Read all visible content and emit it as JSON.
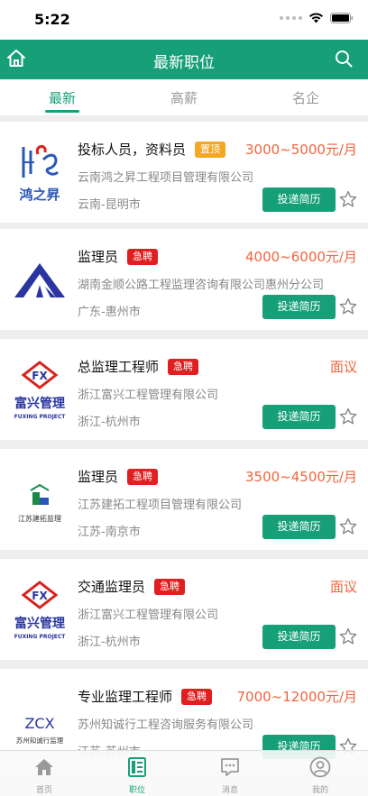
{
  "status": {
    "time": "5:22"
  },
  "header": {
    "title": "最新职位"
  },
  "tabs": [
    {
      "label": "最新"
    },
    {
      "label": "高薪"
    },
    {
      "label": "名企"
    }
  ],
  "colors": {
    "primary": "#17a078",
    "salary": "#f0643c",
    "urgent": "#e02020",
    "top": "#f5a623"
  },
  "jobs": [
    {
      "title": "投标人员，资料员",
      "badge": "置顶",
      "badge_type": "top",
      "salary": "3000~5000元/月",
      "company": "云南鸿之昇工程项目管理有限公司",
      "location": "云南-昆明市",
      "apply": "投递简历",
      "logo": "hong-zhi-sheng-logo",
      "logo_text": "鸿之昇"
    },
    {
      "title": "监理员",
      "badge": "急聘",
      "badge_type": "urgent",
      "salary": "4000~6000元/月",
      "company": "湖南金顺公路工程监理咨询有限公司惠州分公司",
      "location": "广东-惠州市",
      "apply": "投递简历",
      "logo": "jinshun-logo"
    },
    {
      "title": "总监理工程师",
      "badge": "急聘",
      "badge_type": "urgent",
      "salary": "面议",
      "company": "浙江富兴工程管理有限公司",
      "location": "浙江-杭州市",
      "apply": "投递简历",
      "logo": "fuxing-logo",
      "logo_text": "富兴管理",
      "logo_sub": "FUXING PROJECT"
    },
    {
      "title": "监理员",
      "badge": "急聘",
      "badge_type": "urgent",
      "salary": "3500~4500元/月",
      "company": "江苏建拓工程项目管理有限公司",
      "location": "江苏-南京市",
      "apply": "投递简历",
      "logo": "jiantuo-logo",
      "logo_text": "江苏建拓监理"
    },
    {
      "title": "交通监理员",
      "badge": "急聘",
      "badge_type": "urgent",
      "salary": "面议",
      "company": "浙江富兴工程管理有限公司",
      "location": "浙江-杭州市",
      "apply": "投递简历",
      "logo": "fuxing-logo",
      "logo_text": "富兴管理",
      "logo_sub": "FUXING PROJECT"
    },
    {
      "title": "专业监理工程师",
      "badge": "急聘",
      "badge_type": "urgent",
      "salary": "7000~12000元/月",
      "company": "苏州知诚行工程咨询服务有限公司",
      "location": "江苏-苏州市",
      "apply": "投递简历",
      "logo": "zcx-logo",
      "logo_text": "ZCX",
      "logo_sub": "苏州知诚行监理"
    }
  ],
  "bottom_nav": [
    {
      "label": "首页",
      "icon": "home-icon"
    },
    {
      "label": "职位",
      "icon": "document-icon"
    },
    {
      "label": "消息",
      "icon": "message-icon"
    },
    {
      "label": "我的",
      "icon": "user-icon"
    }
  ]
}
